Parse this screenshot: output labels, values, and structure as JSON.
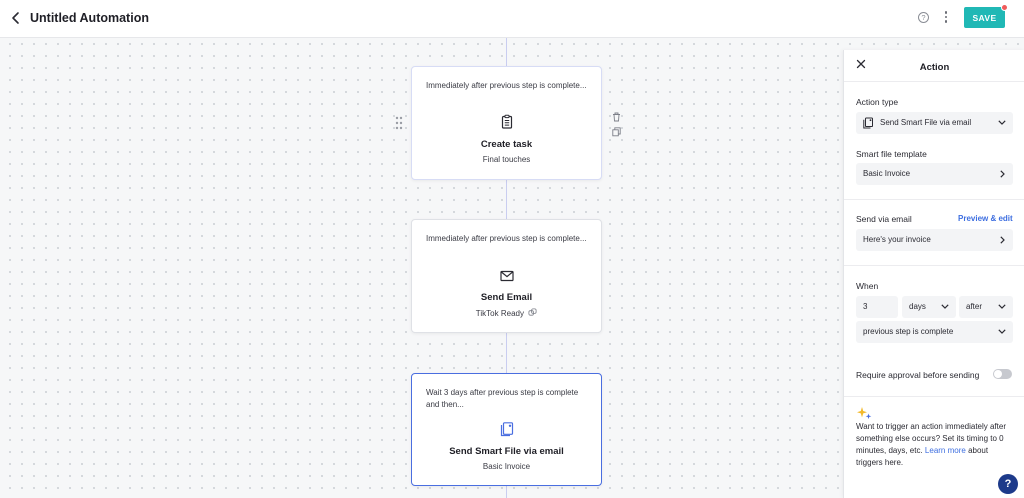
{
  "header": {
    "title": "Untitled Automation",
    "help_icon_text": "?",
    "save_label": "SAVE"
  },
  "steps": [
    {
      "trigger": "Immediately after previous step is complete...",
      "title": "Create task",
      "subtitle": "Final touches",
      "icon": "clipboard-icon"
    },
    {
      "trigger": "Immediately after previous step is complete...",
      "title": "Send Email",
      "subtitle": "TikTok Ready",
      "icon": "envelope-icon"
    },
    {
      "trigger": "Wait 3 days after previous step is complete and then...",
      "title": "Send Smart File via email",
      "subtitle": "Basic Invoice",
      "icon": "smart-file-icon",
      "selected": true
    }
  ],
  "panel": {
    "title": "Action",
    "action_type_label": "Action type",
    "action_type_value": "Send Smart File via email",
    "template_label": "Smart file template",
    "template_value": "Basic Invoice",
    "send_via_label": "Send via email",
    "preview_edit_label": "Preview & edit",
    "email_value": "Here's your invoice",
    "when_label": "When",
    "when_amount": "3",
    "when_unit": "days",
    "when_relation": "after",
    "when_reference": "previous step is complete",
    "approval_label": "Require approval before sending",
    "approval_enabled": false,
    "tip_text": "Want to trigger an action immediately after something else occurs? Set its timing to 0 minutes, days, etc. Learn more about triggers here.",
    "tip_link": "Learn more"
  },
  "help_fab_text": "?",
  "colors": {
    "accent": "#20b8b5",
    "link": "#3d6ee0",
    "selected_border": "#4a6ee0",
    "notification_dot": "#ef5b5b",
    "help_fab": "#1d3a8a"
  }
}
